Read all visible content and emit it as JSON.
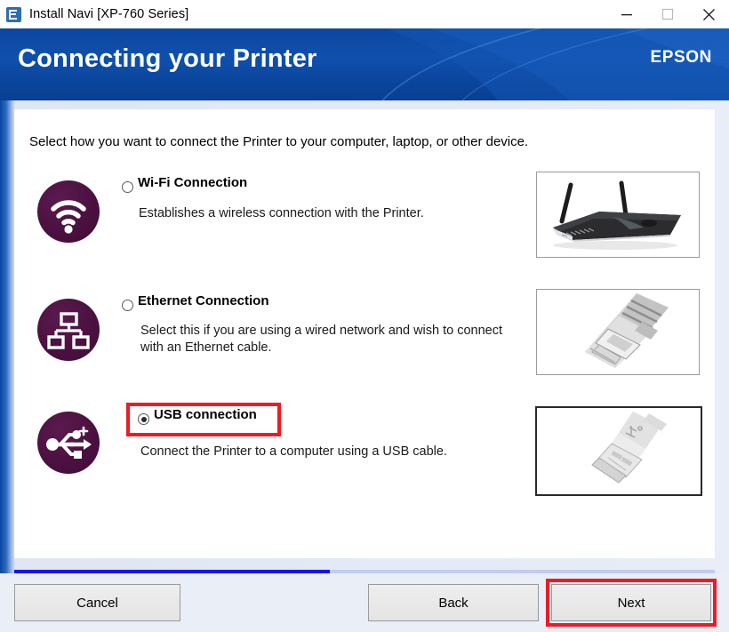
{
  "window": {
    "title": "Install Navi [XP-760 Series]",
    "app_icon": "epson-app-icon",
    "minimize_icon": "minimize-icon",
    "maximize_icon": "maximize-icon",
    "close_icon": "close-icon"
  },
  "header": {
    "title": "Connecting your Printer",
    "brand": "EPSON",
    "background_color": "#0f50ad"
  },
  "main": {
    "instruction": "Select how you want to connect the Printer to your computer, laptop, or other device.",
    "options": [
      {
        "id": "wifi",
        "label": "Wi-Fi Connection",
        "description": "Establishes a wireless connection with the Printer.",
        "selected": false,
        "icon": "wifi-icon",
        "photo": "wireless-router-photo",
        "icon_color": "#4b1140"
      },
      {
        "id": "ethernet",
        "label": "Ethernet Connection",
        "description": "Select this if you are using a wired network and wish to connect with an Ethernet cable.",
        "selected": false,
        "icon": "network-icon",
        "photo": "ethernet-cable-photo",
        "icon_color": "#4b1140"
      },
      {
        "id": "usb",
        "label": "USB connection",
        "description": "Connect the Printer to a computer using a USB cable.",
        "selected": true,
        "icon": "usb-icon",
        "photo": "usb-connector-photo",
        "icon_color": "#4b1140"
      }
    ]
  },
  "progress": {
    "percent": 45,
    "fill_color": "#1414ec",
    "track_color": "#c2cbf2"
  },
  "footer": {
    "cancel_label": "Cancel",
    "back_label": "Back",
    "next_label": "Next"
  },
  "annotations": {
    "highlight_color": "#ed1b24",
    "usb_option_highlighted": true,
    "next_button_highlighted": true
  }
}
